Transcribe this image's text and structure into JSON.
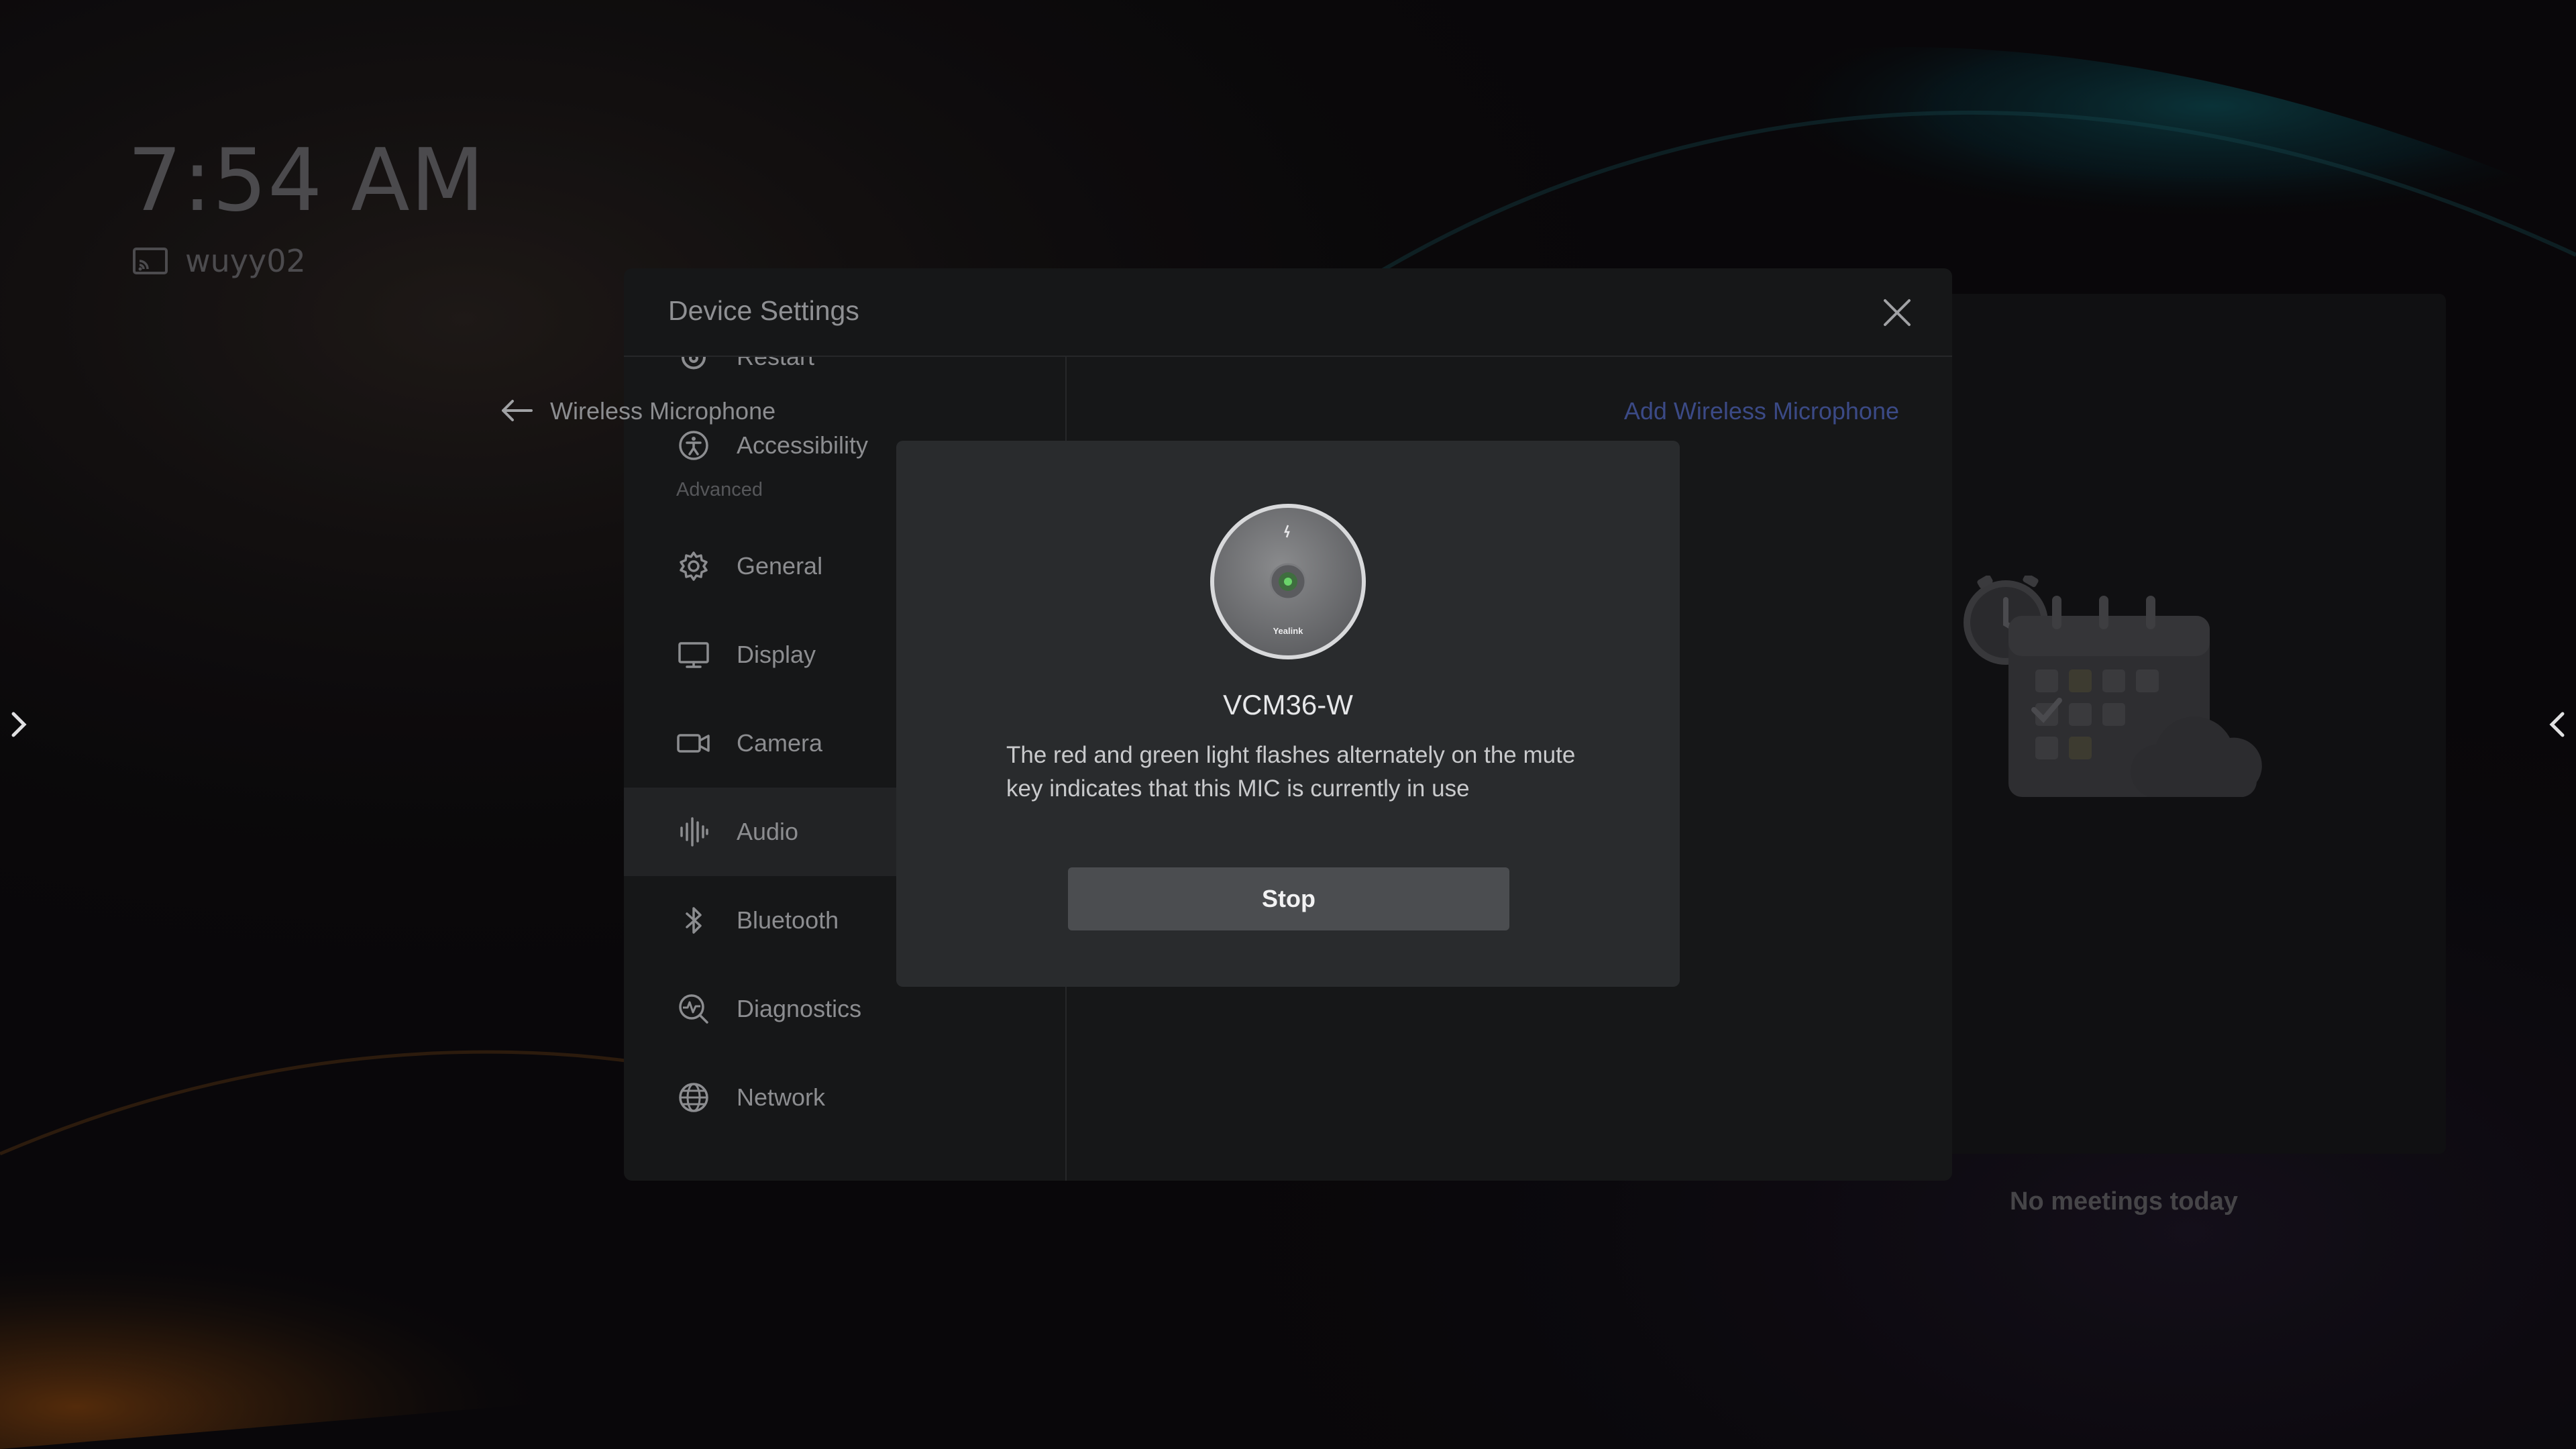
{
  "home": {
    "time": "7:54 AM",
    "device_name": "wuyy02",
    "calendar_empty_text": "No meetings today"
  },
  "settings": {
    "title": "Device Settings",
    "sidebar": {
      "items_top": [
        {
          "label": "Restart",
          "icon": "restart-icon"
        },
        {
          "label": "Accessibility",
          "icon": "accessibility-icon"
        }
      ],
      "section_label": "Advanced",
      "items_advanced": [
        {
          "label": "General",
          "icon": "gear-icon"
        },
        {
          "label": "Display",
          "icon": "monitor-icon"
        },
        {
          "label": "Camera",
          "icon": "camera-icon"
        },
        {
          "label": "Audio",
          "icon": "audio-wave-icon",
          "selected": true
        },
        {
          "label": "Bluetooth",
          "icon": "bluetooth-icon"
        },
        {
          "label": "Diagnostics",
          "icon": "diagnostics-icon"
        },
        {
          "label": "Network",
          "icon": "globe-icon"
        }
      ]
    },
    "content": {
      "title": "Wireless Microphone",
      "add_label": "Add Wireless Microphone"
    }
  },
  "dialog": {
    "mic_brand": "Yealink",
    "mic_model": "VCM36-W",
    "description": "The red and green light flashes alternately on the mute key indicates that this MIC is currently in use",
    "stop_label": "Stop"
  },
  "colors": {
    "accent_link": "#3b4a86",
    "dialog_bg": "#292b2d",
    "modal_bg": "#161718",
    "stop_button": "#4b4d50"
  }
}
